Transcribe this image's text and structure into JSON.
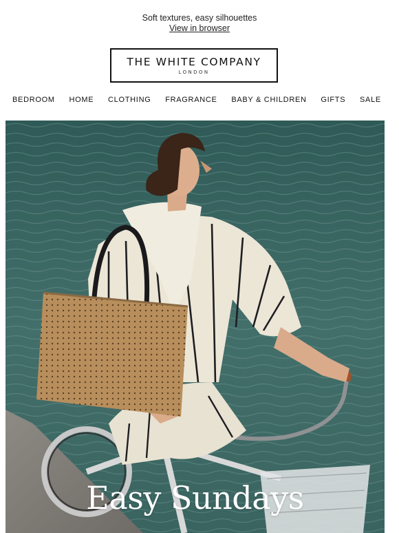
{
  "preheader": {
    "tagline": "Soft textures, easy silhouettes",
    "view_link": "View in browser"
  },
  "logo": {
    "main": "THE WHITE COMPANY",
    "sub": "LONDON"
  },
  "nav": {
    "items": [
      "BEDROOM",
      "HOME",
      "CLOTHING",
      "FRAGRANCE",
      "BABY & CHILDREN",
      "GIFTS",
      "SALE"
    ]
  },
  "hero": {
    "title": "Easy Sundays",
    "water_color": "#3f6b66",
    "jumper_color": "#ece6d6",
    "stripe_color": "#1e1e22",
    "bag_color": "#b88e5c"
  }
}
